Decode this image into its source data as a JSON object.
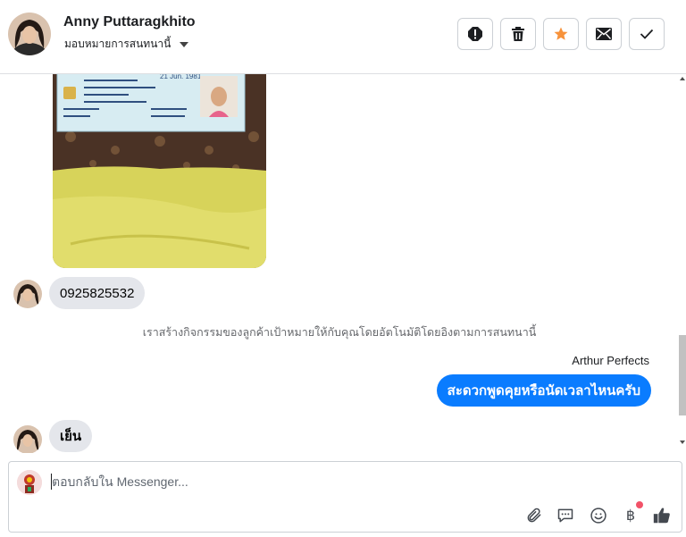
{
  "header": {
    "contact_name": "Anny Puttaragkhito",
    "assign_label": "มอบหมายการสนทนานี้",
    "buttons": [
      "mark-spam",
      "delete",
      "star",
      "mark-unread",
      "mark-done"
    ]
  },
  "messages": {
    "phone_message": "0925825532",
    "system_note": "เราสร้างกิจกรรมของลูกค้าเป้าหมายให้กับคุณโดยอัตโนมัติโดยอิงตามการสนทนานี้",
    "outgoing_sender": "Arthur Perfects",
    "outgoing_message": "สะดวกพูดคุยหรือนัดเวลาไหนครับ",
    "last_incoming": "เย็น"
  },
  "composer": {
    "placeholder": "ตอบกลับใน Messenger...",
    "currency_symbol": "฿"
  },
  "colors": {
    "accent_blue": "#0a7cff",
    "incoming_bubble": "#e4e6eb",
    "star": "#f7923b",
    "notification_dot": "#f25268"
  }
}
